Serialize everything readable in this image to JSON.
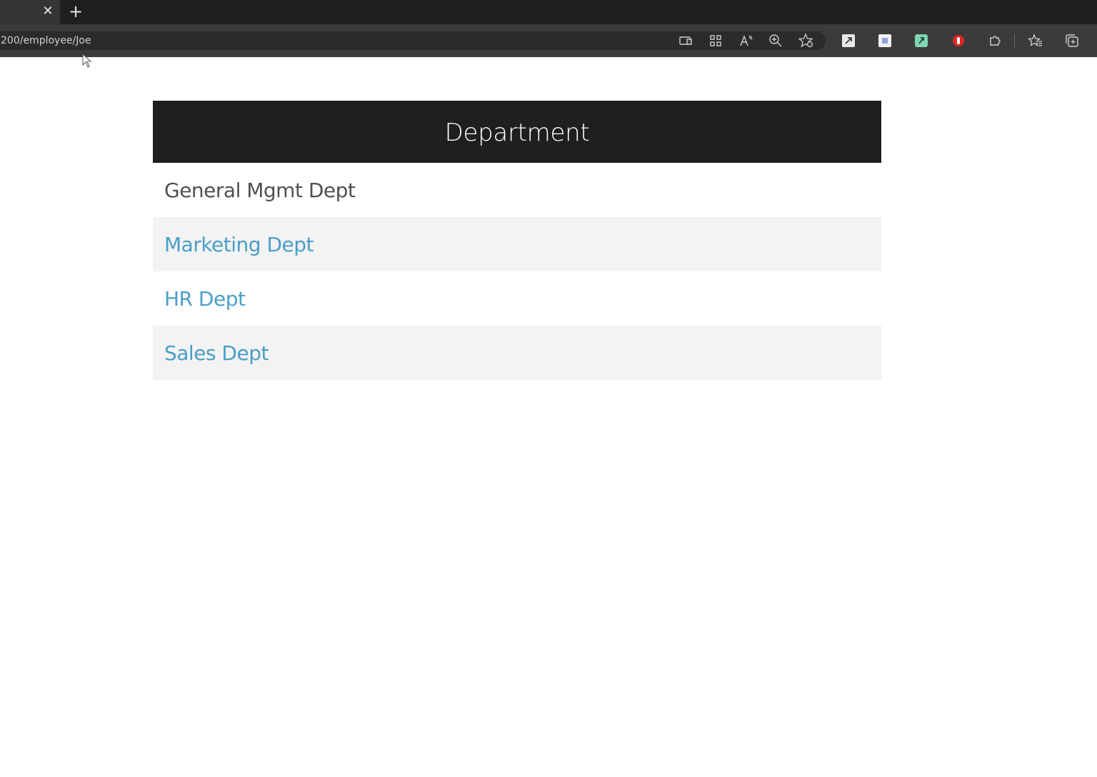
{
  "browser": {
    "tab": {
      "close_glyph": "✕"
    },
    "new_tab_glyph": "+",
    "address": {
      "url": "200/employee/Joe"
    },
    "toolbar_icons": [
      "immersive-reader-icon",
      "app-available-icon",
      "read-aloud-icon",
      "zoom-icon",
      "add-favorite-icon",
      "extension-1-icon",
      "extension-2-icon",
      "extension-3-icon",
      "extension-4-icon",
      "extensions-icon",
      "favorites-icon",
      "collections-icon"
    ]
  },
  "department_panel": {
    "title": "Department",
    "items": [
      {
        "label": "General Mgmt Dept",
        "is_link": false
      },
      {
        "label": "Marketing Dept",
        "is_link": true
      },
      {
        "label": "HR Dept",
        "is_link": true
      },
      {
        "label": "Sales Dept",
        "is_link": true
      }
    ]
  },
  "colors": {
    "header_bg": "#1e1f21",
    "link": "#4a9ec7",
    "plain_text": "#505050",
    "stripe": "#f3f3f3"
  }
}
